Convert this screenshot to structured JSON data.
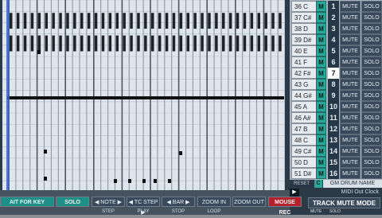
{
  "notes": [
    {
      "name": "36 C",
      "m": "M",
      "num": "1",
      "mute": "MUTE",
      "solo": "SOLO"
    },
    {
      "name": "37 C#",
      "m": "M",
      "num": "2",
      "mute": "MUTE",
      "solo": "SOLO"
    },
    {
      "name": "38 D",
      "m": "M",
      "num": "3",
      "mute": "MUTE",
      "solo": "SOLO"
    },
    {
      "name": "39 D#",
      "m": "M",
      "num": "4",
      "mute": "MUTE",
      "solo": "SOLO"
    },
    {
      "name": "40 E",
      "m": "M",
      "num": "5",
      "mute": "MUTE",
      "solo": "SOLO"
    },
    {
      "name": "41 F",
      "m": "M",
      "num": "6",
      "mute": "MUTE",
      "solo": "SOLO"
    },
    {
      "name": "42 F#",
      "m": "M",
      "num": "7",
      "mute": "MUTE",
      "solo": "SOLO"
    },
    {
      "name": "43 G",
      "m": "M",
      "num": "8",
      "mute": "MUTE",
      "solo": "SOLO"
    },
    {
      "name": "44 G#",
      "m": "M",
      "num": "9",
      "mute": "MUTE",
      "solo": "SOLO"
    },
    {
      "name": "45 A",
      "m": "M",
      "num": "10",
      "mute": "MUTE",
      "solo": "SOLO"
    },
    {
      "name": "46 A#",
      "m": "M",
      "num": "11",
      "mute": "MUTE",
      "solo": "SOLO"
    },
    {
      "name": "47 B",
      "m": "M",
      "num": "12",
      "mute": "MUTE",
      "solo": "SOLO"
    },
    {
      "name": "48 C",
      "m": "M",
      "num": "13",
      "mute": "MUTE",
      "solo": "SOLO"
    },
    {
      "name": "49 C#",
      "m": "M",
      "num": "14",
      "mute": "MUTE",
      "solo": "SOLO"
    },
    {
      "name": "50 D",
      "m": "M",
      "num": "15",
      "mute": "MUTE",
      "solo": "SOLO"
    },
    {
      "name": "51 D#",
      "m": "M",
      "num": "16",
      "mute": "MUTE",
      "solo": "SOLO"
    }
  ],
  "highlighted_index": 6,
  "footer_right": {
    "reset": "RESET",
    "c_label": "C",
    "gm_drum": "GM DRUM NAME",
    "play": "▶",
    "midi_out": "MIDI Out Clock",
    "track_mute": "TRACK MUTE MODE",
    "mute_small": "MUTE",
    "solo_small": "SOLO"
  },
  "toolbar": {
    "wait_for_key": "AIT FOR KEY",
    "solo": "SOLO",
    "note": "◀ NOTE ▶",
    "tc_step": "◀ TC STEP ▶",
    "bar": "◀ BAR ▶",
    "zoom_in": "ZOOM IN",
    "zoom_out": "ZOOM OUT",
    "mouse_rec": "MOUSE REC",
    "step": "STEP",
    "play": "PLAY",
    "stop": "STOP",
    "loop": "LOOP"
  },
  "colors": {
    "accent_teal": "#1d8f86",
    "m_button": "#2aa69a",
    "rec_red": "#b2232d",
    "panel_dark": "#2c3a48"
  }
}
